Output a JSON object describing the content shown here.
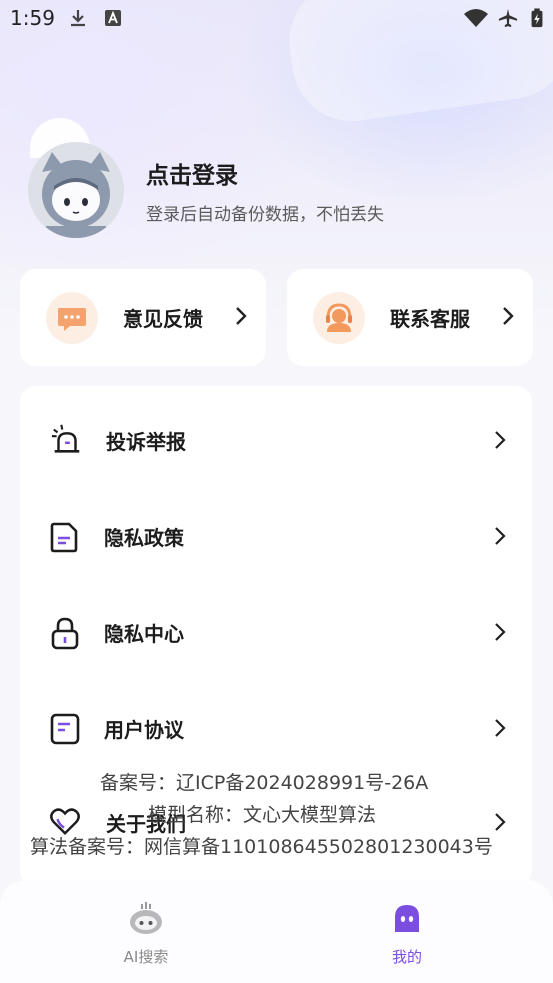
{
  "status_bar": {
    "time": "1:59"
  },
  "profile": {
    "title": "点击登录",
    "subtitle": "登录后自动备份数据，不怕丢失"
  },
  "quick_actions": [
    {
      "label": "意见反馈",
      "icon": "chat-bubble-icon"
    },
    {
      "label": "联系客服",
      "icon": "customer-service-icon"
    }
  ],
  "menu": [
    {
      "label": "投诉举报",
      "icon": "alarm-siren-icon"
    },
    {
      "label": "隐私政策",
      "icon": "document-icon"
    },
    {
      "label": "隐私中心",
      "icon": "lock-icon"
    },
    {
      "label": "用户协议",
      "icon": "agreement-icon"
    },
    {
      "label": "关于我们",
      "icon": "heart-icon"
    }
  ],
  "filing": {
    "record_no": "备案号：辽ICP备2024028991号-26A",
    "model_name": "模型名称：文心大模型算法",
    "algorithm_no": "算法备案号：网信算备110108645502801230043号"
  },
  "bottom_nav": [
    {
      "label": "AI搜索",
      "icon": "robot-icon",
      "active": false
    },
    {
      "label": "我的",
      "icon": "ghost-face-icon",
      "active": true
    }
  ],
  "colors": {
    "accent": "#7b4de0",
    "inactive": "#8a8a8a",
    "warm": "#f29a5e"
  }
}
